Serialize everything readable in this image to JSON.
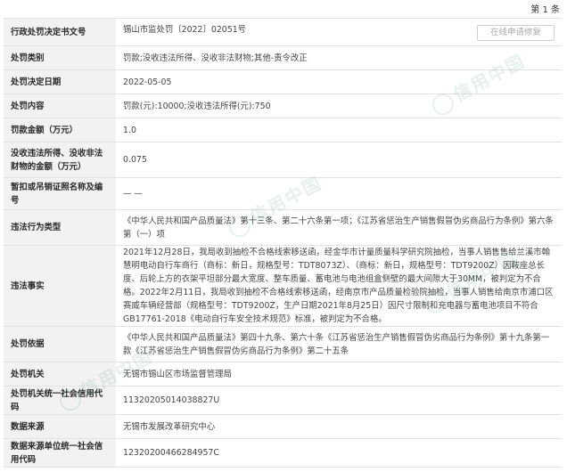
{
  "pager": "第 1 条",
  "repair_button": "在线申请修复",
  "rows": [
    {
      "label": "行政处罚决定书文号",
      "value": "锡山市监处罚〔2022〕02051号"
    },
    {
      "label": "处罚类别",
      "value": "罚款;没收违法所得、没收非法财物;其他-责令改正"
    },
    {
      "label": "处罚决定日期",
      "value": "2022-05-05"
    },
    {
      "label": "处罚内容",
      "value": "罚款(元):10000;没收违法所得(元):750"
    },
    {
      "label": "罚款金额（万元）",
      "value": "1.0"
    },
    {
      "label": "没收违法所得、没收非法财物的金额（万元）",
      "value": "0.075"
    },
    {
      "label": "暂扣或吊销证照名称及编号",
      "value": "— —"
    },
    {
      "label": "违法行为类型",
      "value": "《中华人民共和国产品质量法》第十三条、第二十六条第一项；《江苏省惩治生产销售假冒伪劣商品行为条例》第六条第（一）项"
    },
    {
      "label": "违法事实",
      "value": "2021年12月28日，我局收到抽检不合格线索移送函，经金华市计量质量科学研究院抽检，当事人销售售给兰溪市翰慧明电动自行车商行（商标：新日，规格型号：TDT8073Z）、（商标：新日，规格型号：TDT9200Z）因鞍座总长度、后轮上方的衣架平坦部分最大宽度、整车质量、蓄电池与电池组盒侧壁的最大间隙大于30MM，被判定为不合格。2022年2月11日，我局收到抽检不合格线索移送函，经南京市产品质量检验院抽检，当事人销售给南京市浦口区赛威车辆经营部（规格型号：TDT9200Z，生产日期2021年8月25日）因尺寸限制和充电器与蓄电池项目不符合GB17761-2018《电动自行车安全技术规范》标准，被判定为不合格。"
    },
    {
      "label": "处罚依据",
      "value": "《中华人民共和国产品质量法》第四十九条、第六十条《江苏省惩治生产销售假冒伪劣商品行为条例》第十九条第一款《江苏省惩治生产销售假冒伪劣商品行为条例》第二十五条"
    },
    {
      "label": "处罚机关",
      "value": "无锡市锡山区市场监督管理局"
    },
    {
      "label": "处罚机关统一社会信用代码",
      "value": "11320205014038827U"
    },
    {
      "label": "数据来源",
      "value": "无锡市发展改革研究中心"
    },
    {
      "label": "数据来源单位统一社会信用代码",
      "value": "12320200466284957C"
    }
  ],
  "watermarks": [
    "信用中国",
    "信用中国",
    "信用中国",
    "信用中国"
  ]
}
